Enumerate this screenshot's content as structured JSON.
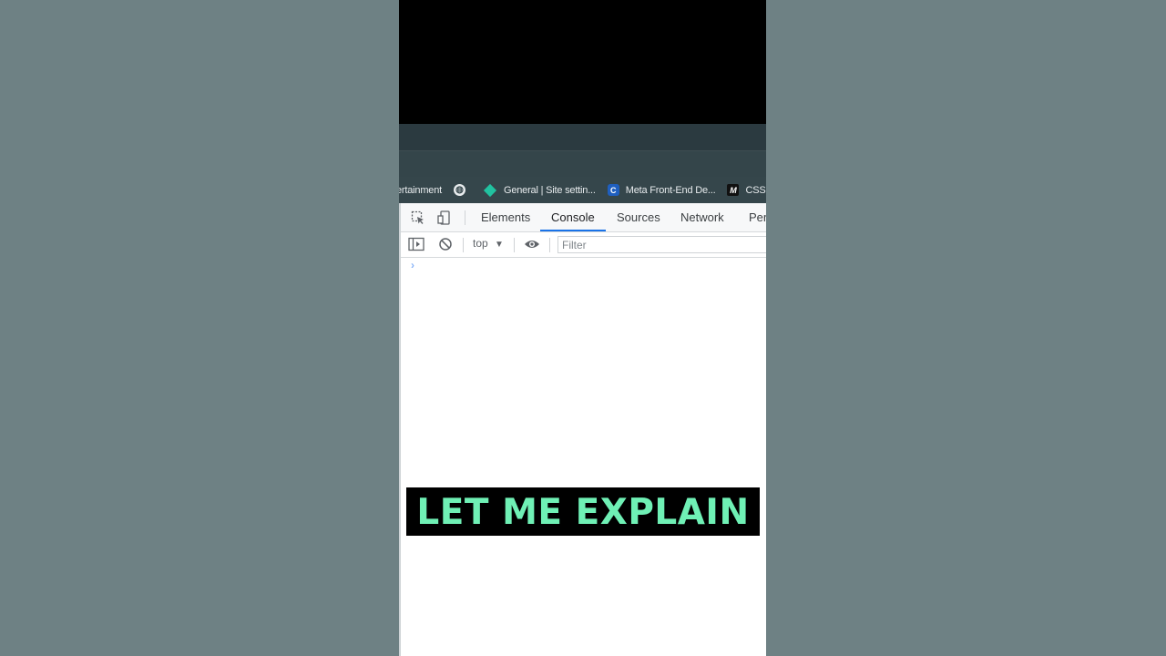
{
  "bookmarks": [
    {
      "label": "ertainment",
      "icon": "none"
    },
    {
      "label": "",
      "icon": "globe-icon"
    },
    {
      "label": "General | Site settin...",
      "icon": "diamond-icon"
    },
    {
      "label": "Meta Front-End De...",
      "icon": "c-logo-icon"
    },
    {
      "label": "CSS Co",
      "icon": "m-logo-icon"
    }
  ],
  "devtools": {
    "tabs": [
      "Elements",
      "Console",
      "Sources",
      "Network",
      "Per"
    ],
    "active_tab": "Console",
    "context": "top",
    "filter_placeholder": "Filter",
    "prompt_symbol": "›"
  },
  "caption": "LET ME EXPLAIN",
  "colors": {
    "background": "#6e8184",
    "caption_text": "#6ff0b5",
    "tab_accent": "#1a73e8"
  }
}
